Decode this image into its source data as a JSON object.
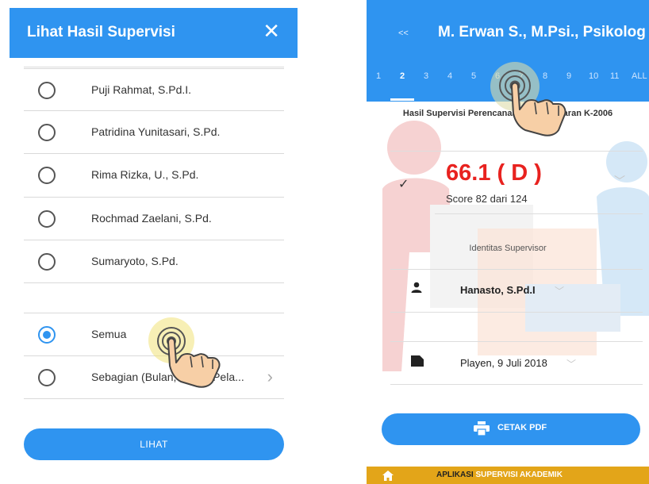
{
  "left": {
    "title": "Lihat Hasil Supervisi",
    "close_icon": "close-icon",
    "options": [
      {
        "label": "Puji Rahmat, S.Pd.I.",
        "selected": false
      },
      {
        "label": "Patridina Yunitasari, S.Pd.",
        "selected": false
      },
      {
        "label": "Rima Rizka, U., S.Pd.",
        "selected": false
      },
      {
        "label": "Rochmad Zaelani, S.Pd.",
        "selected": false
      },
      {
        "label": "Sumaryoto, S.Pd.",
        "selected": false
      }
    ],
    "scope": [
      {
        "label": "Semua",
        "selected": true
      },
      {
        "label": "Sebagian (Bulan, Tahun Pela...",
        "selected": false
      }
    ],
    "button_label": "LIHAT"
  },
  "right": {
    "back_label": "<<",
    "title": "M. Erwan S., M.Psi., Psikolog",
    "tabs": [
      "1",
      "2",
      "3",
      "4",
      "5",
      "6",
      "7",
      "8",
      "9",
      "10",
      "11",
      "ALL"
    ],
    "active_tab": "2",
    "heading": "Hasil Supervisi Perencanaan Pembelajaran K-2006",
    "score": "66.1 ( D )",
    "score_sub": "Score 82 dari 124",
    "identity_label": "Identitas Supervisor",
    "supervisor": "Hanasto, S.Pd.I",
    "place_date": "Playen, 9 Juli 2018",
    "pdf_label": "CETAK PDF",
    "footer_a": "APLIKASI",
    "footer_b": "SUPERVISI AKADEMIK"
  },
  "colors": {
    "primary": "#2f94f0",
    "score_red": "#e8221f",
    "footer_gold": "#e3a519"
  }
}
